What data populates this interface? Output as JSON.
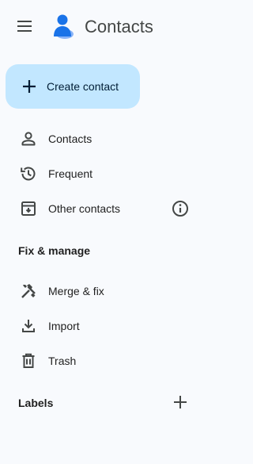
{
  "header": {
    "app_title": "Contacts"
  },
  "create": {
    "label": "Create contact"
  },
  "nav": [
    {
      "label": "Contacts",
      "icon": "person-icon"
    },
    {
      "label": "Frequent",
      "icon": "history-icon"
    },
    {
      "label": "Other contacts",
      "icon": "archive-icon",
      "info_icon": "info-icon"
    }
  ],
  "fix_manage": {
    "title": "Fix & manage",
    "items": [
      {
        "label": "Merge & fix",
        "icon": "tools-icon"
      },
      {
        "label": "Import",
        "icon": "download-icon"
      },
      {
        "label": "Trash",
        "icon": "trash-icon"
      }
    ]
  },
  "labels": {
    "title": "Labels",
    "add_icon": "plus-icon"
  },
  "colors": {
    "background": "#f8fafd",
    "create_button": "#c2e7ff",
    "logo_blue": "#1a73e8",
    "logo_light": "#8ab4f8",
    "icon_gray": "#444746"
  }
}
